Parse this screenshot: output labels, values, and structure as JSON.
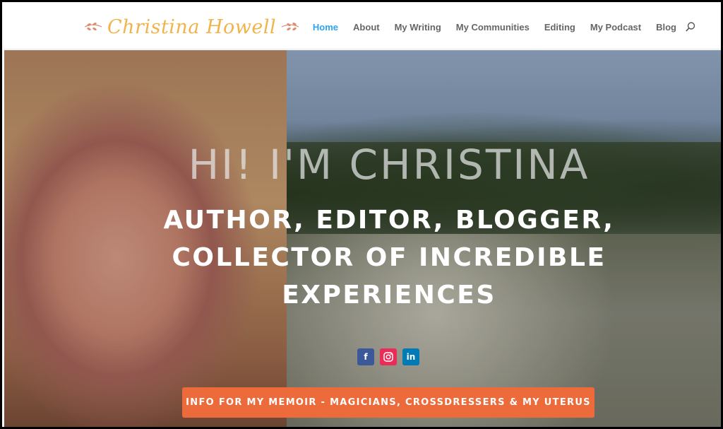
{
  "site": {
    "logo_text": "Christina Howell"
  },
  "nav": {
    "items": [
      {
        "label": "Home",
        "active": true
      },
      {
        "label": "About"
      },
      {
        "label": "My Writing"
      },
      {
        "label": "My Communities"
      },
      {
        "label": "Editing"
      },
      {
        "label": "My Podcast"
      },
      {
        "label": "Blog"
      }
    ],
    "search_icon": "search-icon"
  },
  "hero": {
    "title": "HI! I'M CHRISTINA",
    "subtitle": "AUTHOR, EDITOR, BLOGGER, COLLECTOR OF INCREDIBLE EXPERIENCES",
    "social": [
      {
        "name": "facebook",
        "glyph": "f"
      },
      {
        "name": "instagram",
        "glyph": ""
      },
      {
        "name": "linkedin",
        "glyph": "in"
      }
    ],
    "cta_label": "INFO FOR MY MEMOIR - MAGICIANS, CROSSDRESSERS & MY UTERUS"
  },
  "colors": {
    "accent": "#2ea3f2",
    "logo": "#f0b44a",
    "cta": "#ed6a3b",
    "facebook": "#3b5998",
    "instagram": "#ea2c59",
    "linkedin": "#007bb6"
  }
}
